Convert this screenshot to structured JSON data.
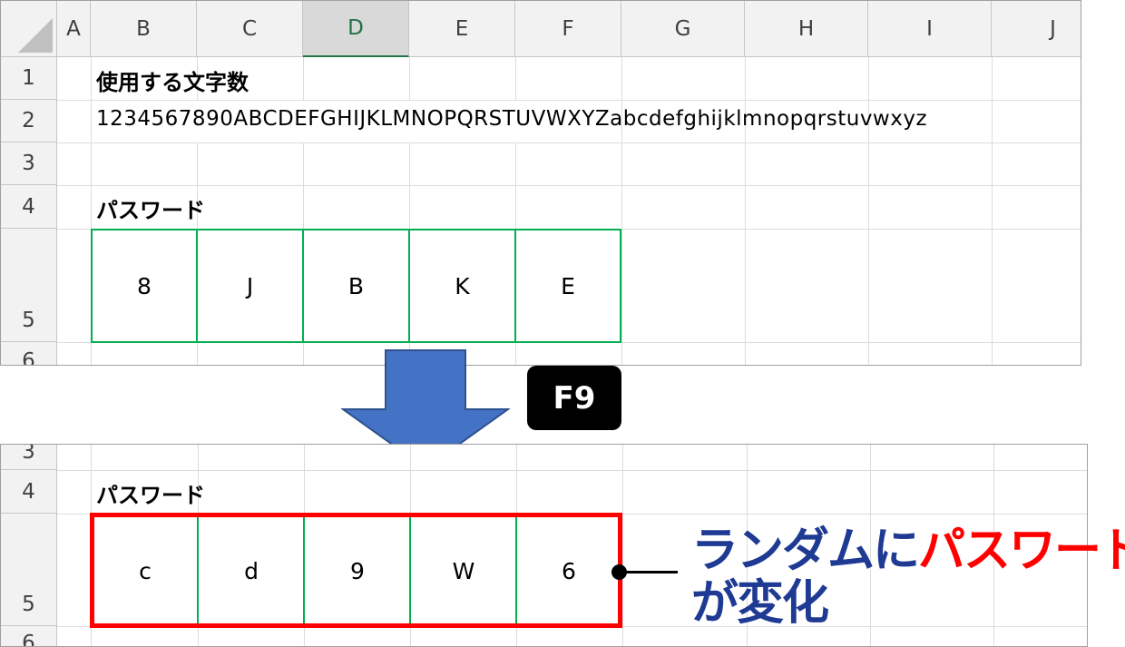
{
  "columns": [
    "A",
    "B",
    "C",
    "D",
    "E",
    "F",
    "G",
    "H",
    "I",
    "J"
  ],
  "selected_column": "D",
  "top_sheet": {
    "rows": [
      "1",
      "2",
      "3",
      "4",
      "5",
      "6"
    ],
    "b1": "使用する文字数",
    "b2": "1234567890ABCDEFGHIJKLMNOPQRSTUVWXYZabcdefghijklmnopqrstuvwxyz",
    "b4": "パスワード",
    "password_chars": [
      "8",
      "J",
      "B",
      "K",
      "E"
    ],
    "password_border_color": "#00b050"
  },
  "key_label": "F9",
  "bottom_sheet": {
    "rows": [
      "3",
      "4",
      "5",
      "6"
    ],
    "b4": "パスワード",
    "password_chars": [
      "c",
      "d",
      "9",
      "W",
      "6"
    ],
    "password_border_color": "#ff0000"
  },
  "callout": {
    "line1_part1": "ランダムに",
    "line1_part2": "パスワード",
    "line2": "が変化"
  },
  "colors": {
    "arrow": "#4472c4",
    "callout_blue": "#1f3a93",
    "callout_red": "#ff0000"
  }
}
